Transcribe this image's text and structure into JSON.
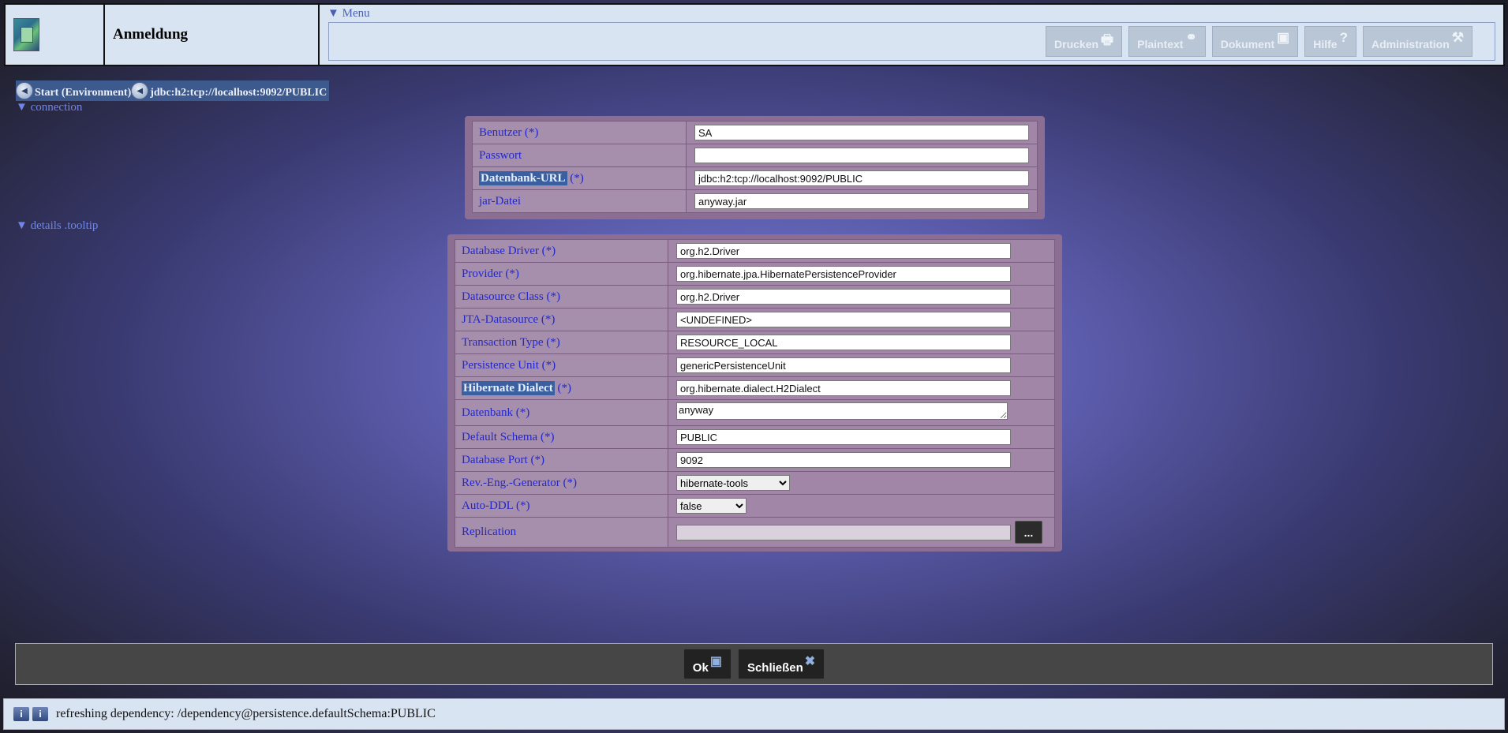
{
  "header": {
    "title": "Anmeldung",
    "menu_label": "Menu",
    "menu_buttons": [
      {
        "label": "Drucken",
        "icon": "printer-icon"
      },
      {
        "label": "Plaintext",
        "icon": "glasses-icon"
      },
      {
        "label": "Dokument",
        "icon": "document-icon"
      },
      {
        "label": "Hilfe",
        "icon": "help-icon"
      },
      {
        "label": "Administration",
        "icon": "tools-icon"
      }
    ]
  },
  "breadcrumb": [
    {
      "label": "Start (Environment)"
    },
    {
      "label": "jdbc:h2:tcp://localhost:9092/PUBLIC"
    }
  ],
  "connection": {
    "toggle_label": "connection",
    "fields": [
      {
        "label": "Benutzer (*)",
        "value": ""
      },
      {
        "label": "Passwort",
        "value": ""
      },
      {
        "label_hl": "Datenbank-URL",
        "label_rest": " (*)",
        "value": "jdbc:h2:tcp://localhost:9092/PUBLIC"
      },
      {
        "label": "jar-Datei",
        "value": "anyway.jar"
      }
    ],
    "user_value": "SA"
  },
  "details": {
    "toggle_label": "details .tooltip",
    "fields": [
      {
        "label": "Database Driver (*)",
        "value": "org.h2.Driver"
      },
      {
        "label": "Provider (*)",
        "value": "org.hibernate.jpa.HibernatePersistenceProvider"
      },
      {
        "label": "Datasource Class (*)",
        "value": "org.h2.Driver"
      },
      {
        "label": "JTA-Datasource (*)",
        "value": "<UNDEFINED>"
      },
      {
        "label": "Transaction Type (*)",
        "value": "RESOURCE_LOCAL"
      },
      {
        "label": "Persistence Unit (*)",
        "value": "genericPersistenceUnit"
      }
    ],
    "dialect_label_hl": "Hibernate Dialect",
    "dialect_label_rest": " (*)",
    "dialect_value": "org.hibernate.dialect.H2Dialect",
    "datenbank_label": "Datenbank (*)",
    "datenbank_value": "anyway",
    "schema_label": "Default Schema (*)",
    "schema_value": "PUBLIC",
    "port_label": "Database Port (*)",
    "port_value": "9092",
    "revgen_label": "Rev.-Eng.-Generator (*)",
    "revgen_value": "hibernate-tools",
    "autoddl_label": "Auto-DDL (*)",
    "autoddl_value": "false",
    "replication_label": "Replication",
    "replication_value": "",
    "replication_button": "..."
  },
  "footer": {
    "ok_label": "Ok",
    "close_label": "Schließen"
  },
  "status": {
    "text": "refreshing dependency: /dependency@persistence.defaultSchema:PUBLIC"
  }
}
